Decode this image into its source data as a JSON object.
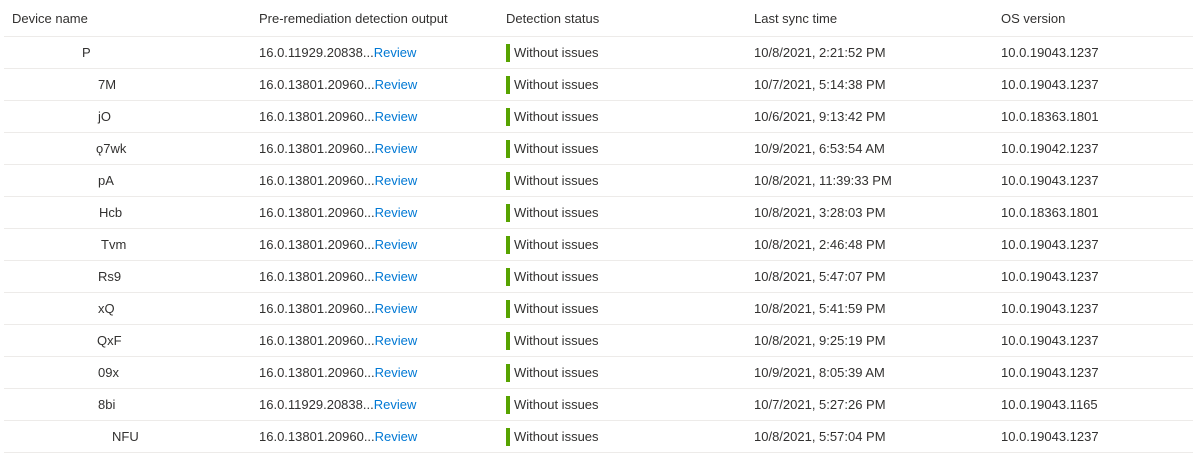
{
  "columns": {
    "device_name": "Device name",
    "pre_output": "Pre-remediation detection output",
    "status": "Detection status",
    "last_sync": "Last sync time",
    "os_version": "OS version"
  },
  "review_label": "Review",
  "status_color": "#57a300",
  "link_color": "#0078d4",
  "rows": [
    {
      "name": "P",
      "output": "16.0.11929.20838...",
      "status": "Without issues",
      "sync": "10/8/2021, 2:21:52 PM",
      "os": "10.0.19043.1237"
    },
    {
      "name": "7M",
      "output": "16.0.13801.20960...",
      "status": "Without issues",
      "sync": "10/7/2021, 5:14:38 PM",
      "os": "10.0.19043.1237"
    },
    {
      "name": "jO",
      "output": "16.0.13801.20960...",
      "status": "Without issues",
      "sync": "10/6/2021, 9:13:42 PM",
      "os": "10.0.18363.1801"
    },
    {
      "name": "ǫ7wk",
      "output": "16.0.13801.20960...",
      "status": "Without issues",
      "sync": "10/9/2021, 6:53:54 AM",
      "os": "10.0.19042.1237"
    },
    {
      "name": "pA",
      "output": "16.0.13801.20960...",
      "status": "Without issues",
      "sync": "10/8/2021, 11:39:33 PM",
      "os": "10.0.19043.1237"
    },
    {
      "name": "Hcb",
      "output": "16.0.13801.20960...",
      "status": "Without issues",
      "sync": "10/8/2021, 3:28:03 PM",
      "os": "10.0.18363.1801"
    },
    {
      "name": "Tvm",
      "output": "16.0.13801.20960...",
      "status": "Without issues",
      "sync": "10/8/2021, 2:46:48 PM",
      "os": "10.0.19043.1237"
    },
    {
      "name": "Rs9",
      "output": "16.0.13801.20960...",
      "status": "Without issues",
      "sync": "10/8/2021, 5:47:07 PM",
      "os": "10.0.19043.1237"
    },
    {
      "name": "xQ",
      "output": "16.0.13801.20960...",
      "status": "Without issues",
      "sync": "10/8/2021, 5:41:59 PM",
      "os": "10.0.19043.1237"
    },
    {
      "name": "QxF",
      "output": "16.0.13801.20960...",
      "status": "Without issues",
      "sync": "10/8/2021, 9:25:19 PM",
      "os": "10.0.19043.1237"
    },
    {
      "name": "09x",
      "output": "16.0.13801.20960...",
      "status": "Without issues",
      "sync": "10/9/2021, 8:05:39 AM",
      "os": "10.0.19043.1237"
    },
    {
      "name": "8bi",
      "output": "16.0.11929.20838...",
      "status": "Without issues",
      "sync": "10/7/2021, 5:27:26 PM",
      "os": "10.0.19043.1165"
    },
    {
      "name": "NFU",
      "output": "16.0.13801.20960...",
      "status": "Without issues",
      "sync": "10/8/2021, 5:57:04 PM",
      "os": "10.0.19043.1237"
    }
  ]
}
